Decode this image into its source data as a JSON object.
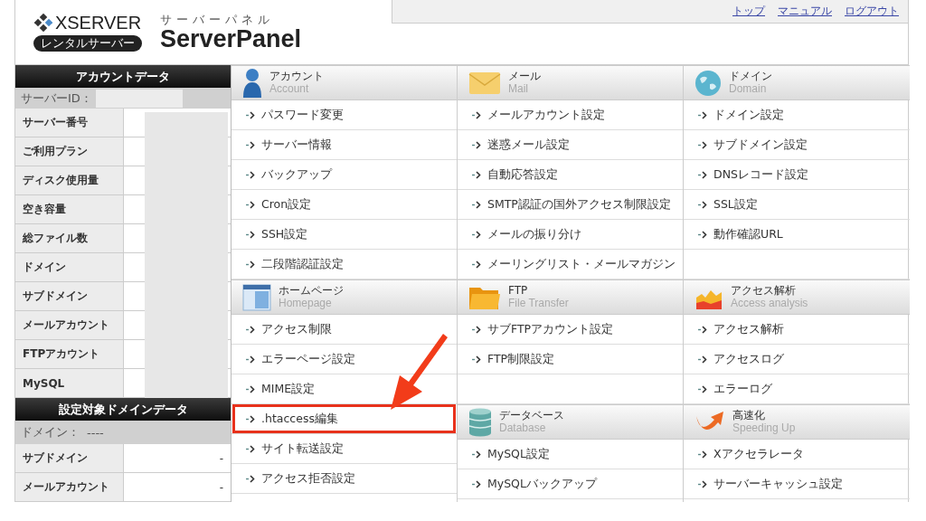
{
  "header": {
    "logo": {
      "brand": "XSERVER",
      "badge": "レンタルサーバー"
    },
    "panel_caption": "サーバーパネル",
    "panel_title": "ServerPanel",
    "nav_links": [
      "トップ",
      "マニュアル",
      "ログアウト"
    ]
  },
  "sidebar": {
    "account_title": "アカウントデータ",
    "server_id_label": "サーバーID：",
    "account_rows": [
      {
        "label": "サーバー番号"
      },
      {
        "label": "ご利用プラン"
      },
      {
        "label": "ディスク使用量"
      },
      {
        "label": "空き容量"
      },
      {
        "label": "総ファイル数"
      },
      {
        "label": "ドメイン"
      },
      {
        "label": "サブドメイン"
      },
      {
        "label": "メールアカウント"
      },
      {
        "label": "FTPアカウント"
      },
      {
        "label": "MySQL"
      }
    ],
    "domain_title": "設定対象ドメインデータ",
    "domain_label": "ドメイン：",
    "domain_value": "----",
    "domain_rows": [
      {
        "label": "サブドメイン",
        "value": "-"
      },
      {
        "label": "メールアカウント",
        "value": "-"
      }
    ]
  },
  "columns": [
    {
      "sections": [
        {
          "title": "アカウント",
          "subtitle": "Account",
          "items": [
            {
              "label": "パスワード変更",
              "highlighted": false
            },
            {
              "label": "サーバー情報",
              "highlighted": false
            },
            {
              "label": "バックアップ",
              "highlighted": false
            },
            {
              "label": "Cron設定",
              "highlighted": false
            },
            {
              "label": "SSH設定",
              "highlighted": false
            },
            {
              "label": "二段階認証設定",
              "highlighted": false
            }
          ]
        },
        {
          "title": "ホームページ",
          "subtitle": "Homepage",
          "items": [
            {
              "label": "アクセス制限",
              "highlighted": false
            },
            {
              "label": "エラーページ設定",
              "highlighted": false
            },
            {
              "label": "MIME設定",
              "highlighted": false
            },
            {
              "label": ".htaccess編集",
              "highlighted": true
            },
            {
              "label": "サイト転送設定",
              "highlighted": false
            },
            {
              "label": "アクセス拒否設定",
              "highlighted": false
            }
          ]
        }
      ]
    },
    {
      "sections": [
        {
          "title": "メール",
          "subtitle": "Mail",
          "items": [
            {
              "label": "メールアカウント設定",
              "highlighted": false
            },
            {
              "label": "迷惑メール設定",
              "highlighted": false
            },
            {
              "label": "自動応答設定",
              "highlighted": false
            },
            {
              "label": "SMTP認証の国外アクセス制限設定",
              "highlighted": false
            },
            {
              "label": "メールの振り分け",
              "highlighted": false
            },
            {
              "label": "メーリングリスト・メールマガジン",
              "highlighted": false
            }
          ]
        },
        {
          "title": "FTP",
          "subtitle": "File Transfer",
          "items": [
            {
              "label": "サブFTPアカウント設定",
              "highlighted": false
            },
            {
              "label": "FTP制限設定",
              "highlighted": false
            }
          ]
        },
        {
          "title": "データベース",
          "subtitle": "Database",
          "items": [
            {
              "label": "MySQL設定",
              "highlighted": false
            },
            {
              "label": "MySQLバックアップ",
              "highlighted": false
            }
          ]
        }
      ]
    },
    {
      "sections": [
        {
          "title": "ドメイン",
          "subtitle": "Domain",
          "items": [
            {
              "label": "ドメイン設定",
              "highlighted": false
            },
            {
              "label": "サブドメイン設定",
              "highlighted": false
            },
            {
              "label": "DNSレコード設定",
              "highlighted": false
            },
            {
              "label": "SSL設定",
              "highlighted": false
            },
            {
              "label": "動作確認URL",
              "highlighted": false
            }
          ]
        },
        {
          "title": "アクセス解析",
          "subtitle": "Access analysis",
          "items": [
            {
              "label": "アクセス解析",
              "highlighted": false
            },
            {
              "label": "アクセスログ",
              "highlighted": false
            },
            {
              "label": "エラーログ",
              "highlighted": false
            }
          ]
        },
        {
          "title": "高速化",
          "subtitle": "Speeding Up",
          "items": [
            {
              "label": "Xアクセラレータ",
              "highlighted": false
            },
            {
              "label": "サーバーキャッシュ設定",
              "highlighted": false
            }
          ]
        }
      ]
    }
  ]
}
